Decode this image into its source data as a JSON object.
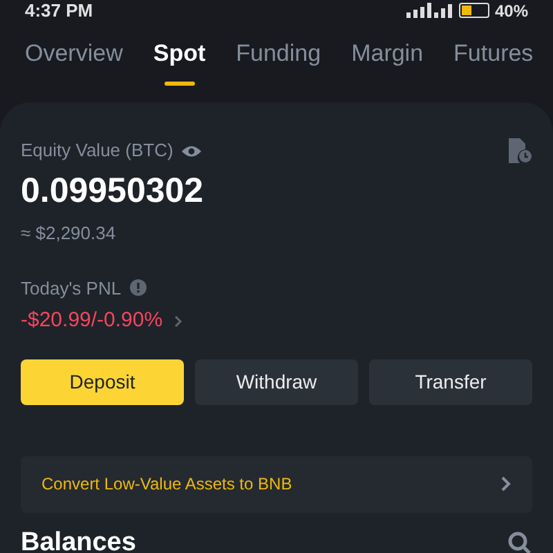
{
  "status_bar": {
    "time": "4:37 PM",
    "battery": "40%"
  },
  "tabs": [
    {
      "label": "Overview",
      "selected": false
    },
    {
      "label": "Spot",
      "selected": true
    },
    {
      "label": "Funding",
      "selected": false
    },
    {
      "label": "Margin",
      "selected": false
    },
    {
      "label": "Futures",
      "selected": false
    }
  ],
  "equity": {
    "label": "Equity Value (BTC)",
    "value": "0.09950302",
    "approx": "≈ $2,290.34"
  },
  "pnl": {
    "label": "Today's PNL",
    "value": "-$20.99/-0.90%"
  },
  "buttons": [
    {
      "label": "Deposit",
      "primary": true
    },
    {
      "label": "Withdraw",
      "primary": false
    },
    {
      "label": "Transfer",
      "primary": false
    }
  ],
  "banner": {
    "text": "Convert Low-Value Assets to BNB"
  },
  "balances": {
    "title": "Balances"
  }
}
